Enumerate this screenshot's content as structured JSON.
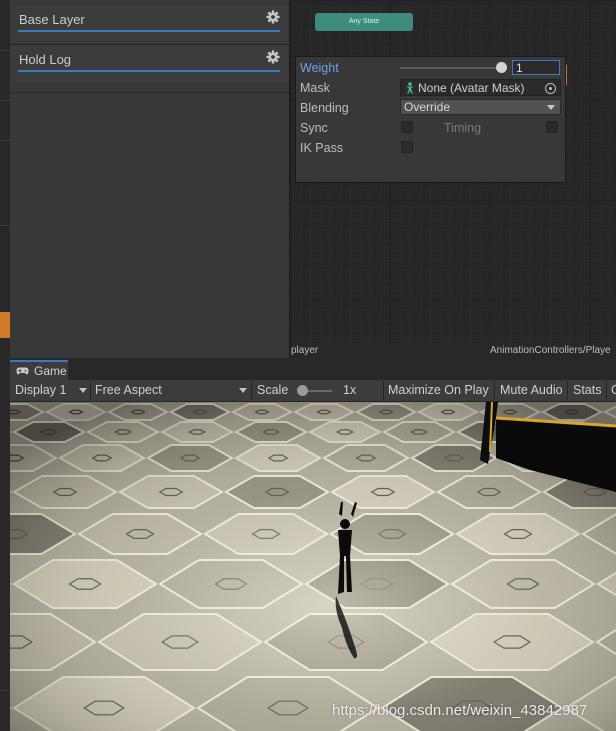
{
  "layers_panel": {
    "layers": [
      {
        "name": "Base Layer",
        "icon": "gear-icon"
      },
      {
        "name": "Hold Log",
        "icon": "gear-icon"
      }
    ]
  },
  "graph": {
    "any_state_label": "Any State"
  },
  "layer_settings": {
    "weight_label": "Weight",
    "weight_value": "1",
    "weight_slider_fraction": 1.0,
    "mask_label": "Mask",
    "mask_value": "None (Avatar Mask)",
    "blending_label": "Blending",
    "blending_value": "Override",
    "sync_label": "Sync",
    "sync_checked": false,
    "timing_label": "Timing",
    "timing_checked": false,
    "ik_pass_label": "IK Pass",
    "ik_pass_checked": false
  },
  "animator_footer": {
    "left_text": "player",
    "right_text": "AnimationControllers/Playe"
  },
  "game_tab": {
    "label": "Game",
    "icon": "gamepad-icon"
  },
  "game_toolbar": {
    "display": "Display 1",
    "aspect": "Free Aspect",
    "scale_label": "Scale",
    "scale_value": "1x",
    "maximize": "Maximize On Play",
    "mute": "Mute Audio",
    "stats": "Stats",
    "gizmos": "G"
  },
  "watermark": "https://blog.csdn.net/weixin_43842987",
  "colors": {
    "accent_blue": "#3a79c3",
    "any_state_green": "#3e8c7b",
    "node_orange": "#c87822"
  }
}
